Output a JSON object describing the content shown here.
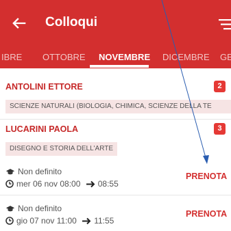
{
  "appbar": {
    "title": "Colloqui",
    "back_icon": "arrow-left-icon",
    "filter_icon": "filter-icon",
    "color": "#d32f2f"
  },
  "tabs": [
    {
      "label": "IBRE"
    },
    {
      "label": "OTTOBRE"
    },
    {
      "label": "NOVEMBRE",
      "active": true
    },
    {
      "label": "DICEMBRE"
    },
    {
      "label": "GE"
    }
  ],
  "teachers": [
    {
      "name": "ANTOLINI ETTORE",
      "count": "2",
      "subject": "SCIENZE NATURALI (BIOLOGIA, CHIMICA, SCIENZE DELLA TE"
    },
    {
      "name": "LUCARINI PAOLA",
      "count": "3",
      "subject": "DISEGNO E STORIA DELL'ARTE",
      "slots": [
        {
          "type": "Non definito",
          "day": "mer 06 nov 08:00",
          "end": "08:55",
          "action": "PRENOTA"
        },
        {
          "type": "Non definito",
          "day": "gio 07 nov 11:00",
          "end": "11:55",
          "action": "PRENOTA"
        }
      ]
    }
  ]
}
